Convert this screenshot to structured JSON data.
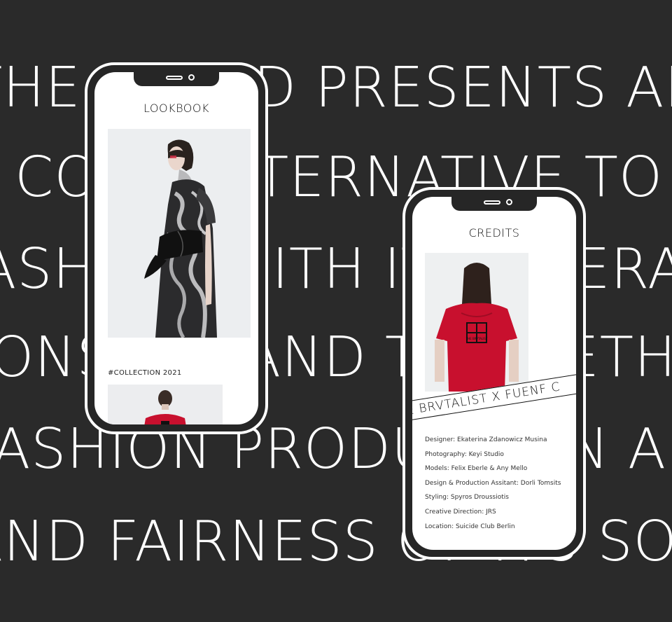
{
  "background": {
    "color": "#2a2a2a",
    "lines": [
      "THE BRAND PRESENTS AN",
      "A COOL ALTERNATIVE TO FAST",
      "FASHION WITH ITS LIBERATION",
      "CONSENT AND THE METHODS",
      "FASHION PRODUCTION AND FABRIC",
      "AND FAIRNESS OF ITS SOURCING"
    ]
  },
  "lookbook_phone": {
    "title": "LOOKBOOK",
    "collection_label": "#COLLECTION 2021"
  },
  "credits_phone": {
    "title": "CREDITS",
    "banner_text": "E BRVTALIST X FUENF C",
    "logo_text": "THE BRVTALIST",
    "credits": [
      "Designer: Ekaterina Zdanowicz Musina",
      "Photography: Keyi Studio",
      "Models: Felix Eberle & Any Mello",
      "Design & Production Assitant: Dorli Tomsits",
      "Styling: Spyros Droussiotis",
      "Creative Direction: JRS",
      "Location: Suicide Club Berlin"
    ]
  },
  "colors": {
    "accent_red": "#c8102e",
    "phone_frame": "#ffffff"
  }
}
